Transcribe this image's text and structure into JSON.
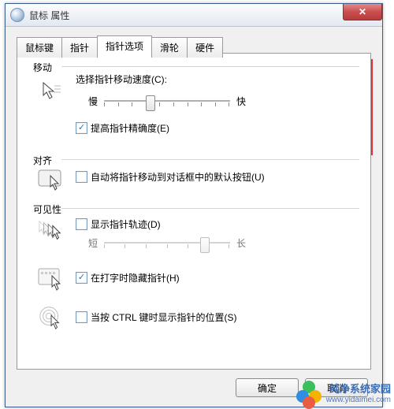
{
  "window": {
    "title": "鼠标 属性",
    "close_glyph": "✕"
  },
  "tabs": {
    "items": [
      {
        "label": "鼠标键"
      },
      {
        "label": "指针"
      },
      {
        "label": "指针选项"
      },
      {
        "label": "滑轮"
      },
      {
        "label": "硬件"
      }
    ],
    "active_index": 2
  },
  "motion": {
    "legend": "移动",
    "speed_label": "选择指针移动速度(C):",
    "slow_label": "慢",
    "fast_label": "快",
    "slider_pos": 0.35,
    "precision_checked": true,
    "precision_label": "提高指针精确度(E)"
  },
  "snap": {
    "legend": "对齐",
    "checked": false,
    "label": "自动将指针移动到对话框中的默认按钮(U)"
  },
  "visibility": {
    "legend": "可见性",
    "trails_checked": false,
    "trails_label": "显示指针轨迹(D)",
    "short_label": "短",
    "long_label": "长",
    "trail_slider_pos": 0.78,
    "hide_typing_checked": true,
    "hide_typing_label": "在打字时隐藏指针(H)",
    "ctrl_checked": false,
    "ctrl_label": "当按 CTRL 键时显示指针的位置(S)"
  },
  "buttons": {
    "ok": "确定",
    "cancel": "取消"
  },
  "watermark": {
    "line1": "纯净系统家园",
    "line2": "www.yidaimei.com"
  }
}
